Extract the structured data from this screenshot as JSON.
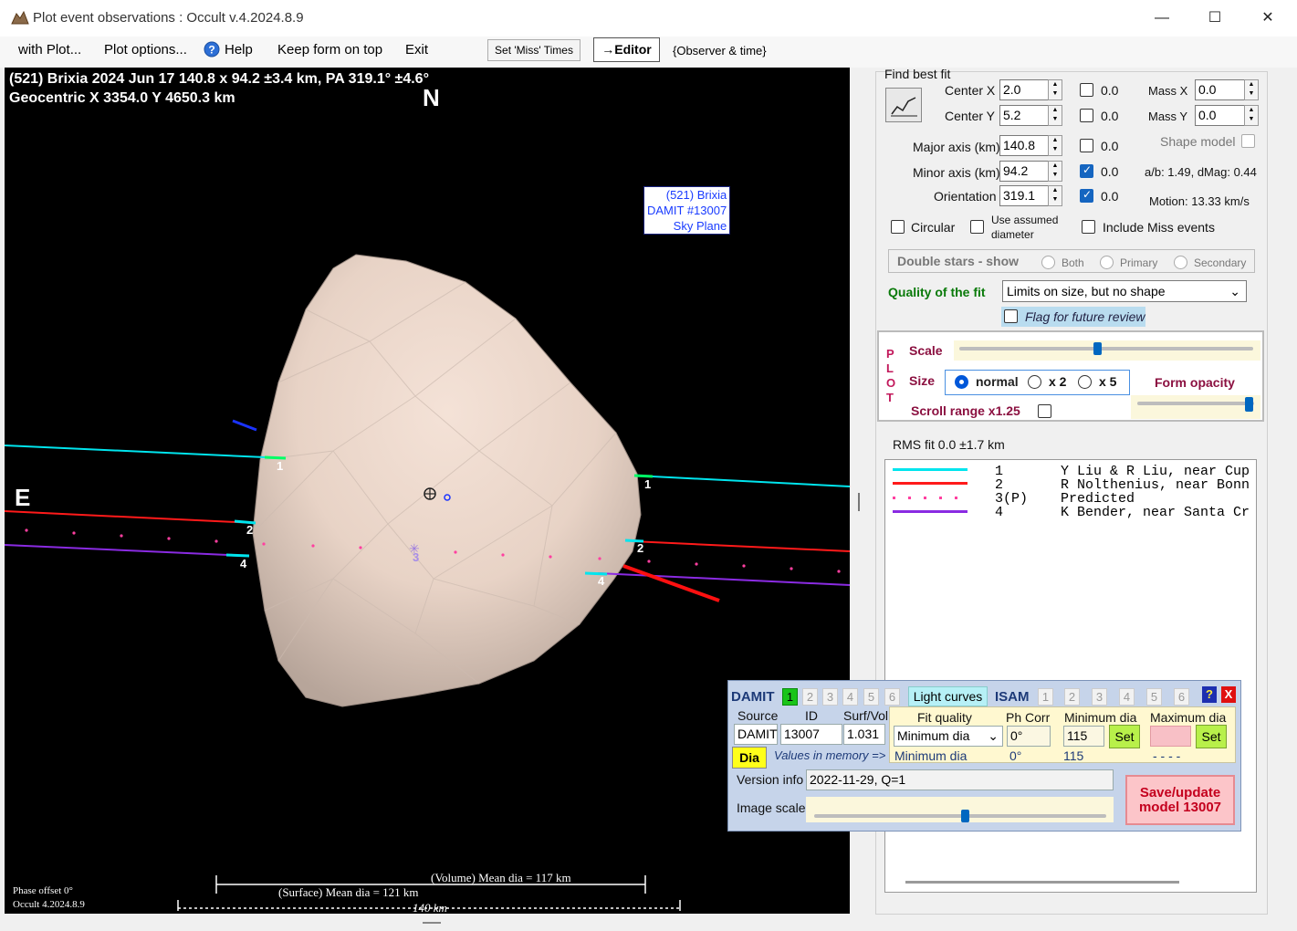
{
  "window": {
    "title": "Plot event observations : Occult v.4.2024.8.9",
    "controls": [
      "—",
      "☐",
      "✕"
    ]
  },
  "menu": {
    "items": [
      "with Plot...",
      "Plot options...",
      "Help",
      "Keep form on top",
      "Exit"
    ],
    "set_miss_times": "Set 'Miss' Times",
    "editor": "→Editor",
    "observer_time": "{Observer & time}"
  },
  "plot": {
    "header_line1": "(521) Brixia  2024 Jun 17   140.8 x 94.2 ±3.4 km,  PA 319.1° ±4.6°",
    "header_line2": "Geocentric  X  3354.0  Y 4650.3 km",
    "north": "N",
    "east": "E",
    "legend": [
      "(521) Brixia",
      "DAMIT #13007",
      "Sky Plane"
    ],
    "chord_labels": [
      "1",
      "2",
      "3",
      "4"
    ],
    "volume_dia": "(Volume) Mean dia = 117 km",
    "surface_dia": "(Surface) Mean dia = 121 km",
    "scale_label": "140 km",
    "phase_offset": "Phase offset 0°",
    "version": "Occult 4.2024.8.9",
    "colors": {
      "chord1": "#00e5ee",
      "chord2": "#ff1a1a",
      "chord3": "#ff3fa0",
      "chord4": "#8a2be2",
      "asteroid": "#e8d6cc"
    }
  },
  "fit": {
    "section_title": "Find best fit",
    "center_x_label": "Center X",
    "center_x": "2.0",
    "center_y_label": "Center Y",
    "center_y": "5.2",
    "major_label": "Major axis (km)",
    "major": "140.8",
    "minor_label": "Minor axis (km)",
    "minor": "94.2",
    "orient_label": "Orientation",
    "orient": "319.1",
    "cb_values": [
      "0.0",
      "0.0",
      "0.0",
      "0.0",
      "0.0"
    ],
    "mass_x_label": "Mass X",
    "mass_x": "0.0",
    "mass_y_label": "Mass Y",
    "mass_y": "0.0",
    "shape_model": "Shape model",
    "ab_text": "a/b: 1.49, dMag: 0.44",
    "motion_text": "Motion: 13.33 km/s",
    "circular": "Circular",
    "use_assumed": "Use assumed",
    "diameter": "diameter",
    "include_miss": "Include Miss events",
    "double_stars": "Double stars - show",
    "both": "Both",
    "primary": "Primary",
    "secondary": "Secondary",
    "quality_label": "Quality of the fit",
    "quality_value": "Limits on size, but no shape",
    "flag_review": "Flag for future review"
  },
  "plot_box": {
    "letters": [
      "P",
      "L",
      "O",
      "T"
    ],
    "scale": "Scale",
    "size": "Size",
    "normal": "normal",
    "x2": "x 2",
    "x5": "x 5",
    "form_opacity": "Form opacity",
    "scroll_range": "Scroll range x1.25"
  },
  "rms": "RMS fit 0.0 ±1.7 km",
  "observations": [
    {
      "num": "1",
      "text": "1       Y Liu & R Liu, near Cup",
      "color": "#00e5ee"
    },
    {
      "num": "2",
      "text": "2       R Nolthenius, near Bonn",
      "color": "#ff1a1a"
    },
    {
      "num": "3",
      "text": "3(P)    Predicted",
      "color": "#ff3fa0"
    },
    {
      "num": "4",
      "text": "4       K Bender, near Santa Cr",
      "color": "#8a2be2"
    }
  ],
  "damit": {
    "label": "DAMIT",
    "tabs": [
      "1",
      "2",
      "3",
      "4",
      "5",
      "6"
    ],
    "light_curves": "Light curves",
    "isam": "ISAM",
    "isam_tabs": [
      "1",
      "2",
      "3",
      "4",
      "5",
      "6"
    ],
    "help": "?",
    "close": "X",
    "source_label": "Source",
    "id_label": "ID",
    "surf_label": "Surf/Vol",
    "source": "DAMIT",
    "id": "13007",
    "surf": "1.031",
    "fit_quality_label": "Fit quality",
    "ph_corr_label": "Ph Corr",
    "min_dia_label": "Minimum dia",
    "max_dia_label": "Maximum dia",
    "fit_quality": "Minimum dia",
    "ph_corr": "0°",
    "min_dia": "115",
    "set": "Set",
    "dia_btn": "Dia",
    "values_in_memory": "Values in memory =>",
    "mem_fit": "Minimum dia",
    "mem_ph": "0°",
    "mem_min": "115",
    "mem_max": "- - - -",
    "version_label": "Version info",
    "version": "2022-11-29, Q=1",
    "image_scale": "Image scale",
    "save_line1": "Save/update",
    "save_line2": "model 13007"
  }
}
